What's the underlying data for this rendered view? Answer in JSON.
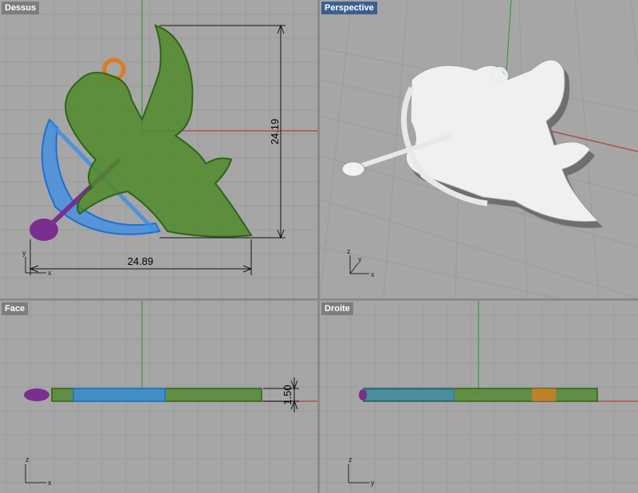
{
  "viewports": {
    "top": {
      "label": "Dessus"
    },
    "perspective": {
      "label": "Perspective"
    },
    "front": {
      "label": "Face"
    },
    "right": {
      "label": "Droite"
    }
  },
  "dimensions": {
    "height": "24.19",
    "width": "24.89",
    "thickness": "1.50"
  },
  "axes": {
    "x": "x",
    "y": "y",
    "z": "z"
  },
  "colors": {
    "grid_bg": "#a6a6a6",
    "grid_line": "#9a9a9a",
    "grid_major": "#8e8e8e",
    "axis_x": "#b04040",
    "axis_y": "#3c9a3c",
    "body": "#4f8a2a",
    "bow": "#3a8ee6",
    "arrow": "#7a2f8f",
    "ring": "#e07a20",
    "active_label_bg": "#3c5f8f"
  }
}
